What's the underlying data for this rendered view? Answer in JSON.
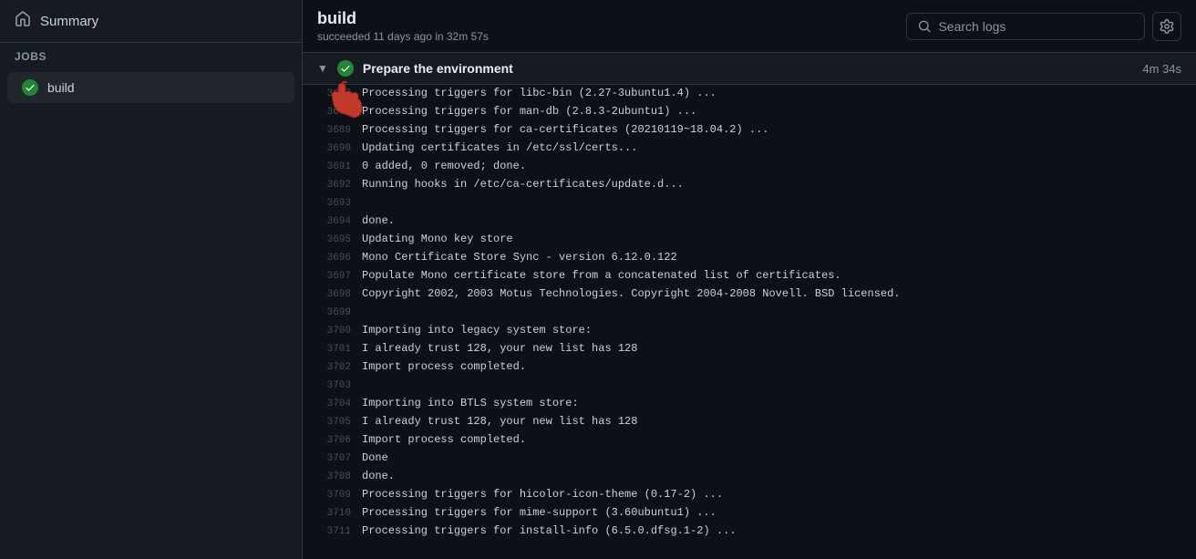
{
  "sidebar": {
    "summary_label": "Summary",
    "home_icon": "home",
    "jobs_label": "Jobs",
    "jobs": [
      {
        "id": "build",
        "label": "build",
        "status": "success"
      }
    ]
  },
  "header": {
    "title": "build",
    "subtitle": "succeeded 11 days ago in 32m 57s",
    "search_placeholder": "Search logs",
    "gear_icon": "settings"
  },
  "step": {
    "title": "Prepare the environment",
    "duration": "4m 34s",
    "status": "success"
  },
  "log_lines": [
    {
      "number": "3687",
      "text": "Processing triggers for libc-bin (2.27-3ubuntu1.4) ..."
    },
    {
      "number": "3688",
      "text": "Processing triggers for man-db (2.8.3-2ubuntu1) ..."
    },
    {
      "number": "3689",
      "text": "Processing triggers for ca-certificates (20210119~18.04.2) ..."
    },
    {
      "number": "3690",
      "text": "Updating certificates in /etc/ssl/certs..."
    },
    {
      "number": "3691",
      "text": "0 added, 0 removed; done."
    },
    {
      "number": "3692",
      "text": "Running hooks in /etc/ca-certificates/update.d..."
    },
    {
      "number": "3693",
      "text": ""
    },
    {
      "number": "3694",
      "text": "done."
    },
    {
      "number": "3695",
      "text": "Updating Mono key store"
    },
    {
      "number": "3696",
      "text": "Mono Certificate Store Sync - version 6.12.0.122"
    },
    {
      "number": "3697",
      "text": "Populate Mono certificate store from a concatenated list of certificates."
    },
    {
      "number": "3698",
      "text": "Copyright 2002, 2003 Motus Technologies. Copyright 2004-2008 Novell. BSD licensed."
    },
    {
      "number": "3699",
      "text": ""
    },
    {
      "number": "3700",
      "text": "Importing into legacy system store:"
    },
    {
      "number": "3701",
      "text": "I already trust 128, your new list has 128"
    },
    {
      "number": "3702",
      "text": "Import process completed."
    },
    {
      "number": "3703",
      "text": ""
    },
    {
      "number": "3704",
      "text": "Importing into BTLS system store:"
    },
    {
      "number": "3705",
      "text": "I already trust 128, your new list has 128"
    },
    {
      "number": "3706",
      "text": "Import process completed."
    },
    {
      "number": "3707",
      "text": "Done"
    },
    {
      "number": "3708",
      "text": "done."
    },
    {
      "number": "3709",
      "text": "Processing triggers for hicolor-icon-theme (0.17-2) ..."
    },
    {
      "number": "3710",
      "text": "Processing triggers for mime-support (3.60ubuntu1) ..."
    },
    {
      "number": "3711",
      "text": "Processing triggers for install-info (6.5.0.dfsg.1-2) ..."
    }
  ]
}
